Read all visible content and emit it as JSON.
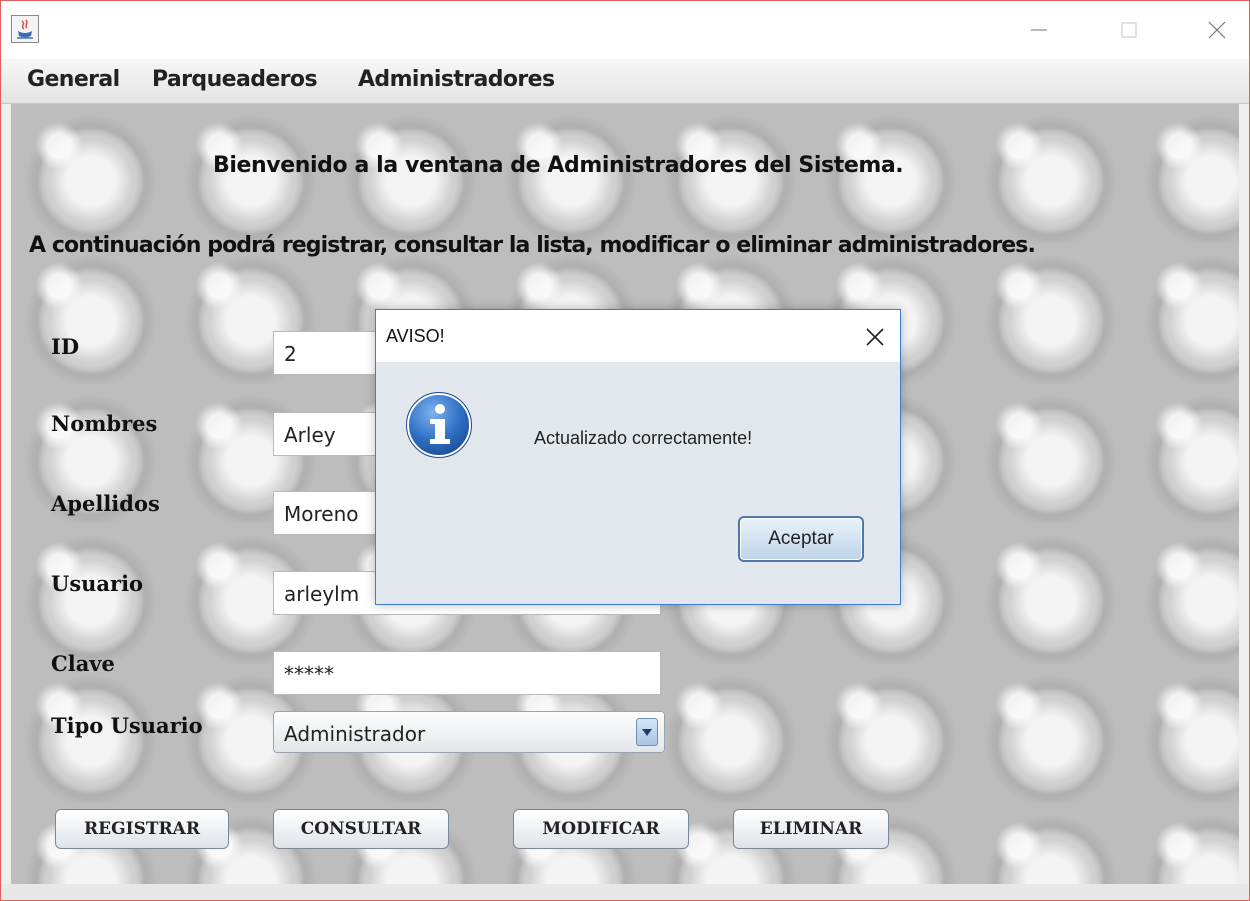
{
  "menu": {
    "items": [
      {
        "label": "General"
      },
      {
        "label": "Parqueaderos"
      },
      {
        "label": "Administradores"
      }
    ]
  },
  "content": {
    "welcome": "Bienvenido a la ventana de Administradores del Sistema.",
    "instructions": "A continuación podrá registrar, consultar la lista, modificar o eliminar administradores."
  },
  "form": {
    "id": {
      "label": "ID",
      "value": "2"
    },
    "nombres": {
      "label": "Nombres",
      "value": "Arley"
    },
    "apellidos": {
      "label": "Apellidos",
      "value": "Moreno"
    },
    "usuario": {
      "label": "Usuario",
      "value": "arleylm"
    },
    "clave": {
      "label": "Clave",
      "value": "*****"
    },
    "tipo_usuario": {
      "label": "Tipo Usuario",
      "value": "Administrador"
    }
  },
  "buttons": {
    "registrar": "REGISTRAR",
    "consultar": "CONSULTAR",
    "modificar": "MODIFICAR",
    "eliminar": "ELIMINAR"
  },
  "dialog": {
    "title": "AVISO!",
    "message": "Actualizado correctamente!",
    "ok_label": "Aceptar",
    "icon": "info-icon"
  },
  "colors": {
    "window_border": "#e06060",
    "dialog_border": "#3c7fd2",
    "info_icon": "#2f6fc4"
  }
}
